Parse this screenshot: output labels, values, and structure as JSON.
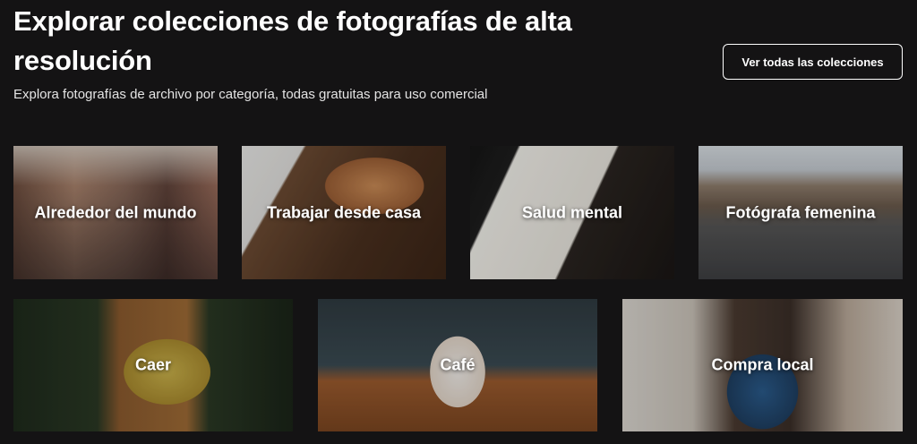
{
  "header": {
    "title": "Explorar colecciones de fotografías de alta resolución",
    "subtitle": "Explora fotografías de archivo por categoría, todas gratuitas para uso comercial",
    "view_all_label": "Ver todas las colecciones"
  },
  "collections": [
    {
      "label": "Alrededor del mundo"
    },
    {
      "label": "Trabajar desde casa"
    },
    {
      "label": "Salud mental"
    },
    {
      "label": "Fotógrafa femenina"
    },
    {
      "label": "Caer"
    },
    {
      "label": "Café"
    },
    {
      "label": "Compra local"
    }
  ],
  "colors": {
    "background": "#141314",
    "text": "#ffffff",
    "button_border": "#ffffff"
  }
}
